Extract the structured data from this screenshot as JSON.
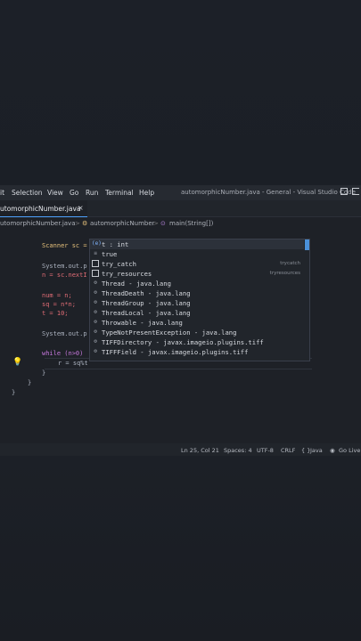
{
  "menubar": {
    "items": [
      "it",
      "Selection",
      "View",
      "Go",
      "Run",
      "Terminal",
      "Help"
    ],
    "window_title": "automorphicNumber.java - General - Visual Studio Code"
  },
  "tab": {
    "label": "utomorphicNumber.java",
    "close": "×"
  },
  "breadcrumb": {
    "file": "utomorphicNumber.java",
    "class": "automorphicNumber",
    "method": "main(String[])",
    "sep": ">"
  },
  "code": {
    "line_scanner": "Scanner sc =",
    "line_print": "System.out.p",
    "line_n": "n = sc.nextI",
    "line_num": "num = n;",
    "line_sq": "sq = n*n;",
    "line_t": "t = 10;",
    "line_print2": "System.out.p",
    "line_while": "while (n>0)",
    "line_r": "r = sq%t",
    "brace_inner": "}",
    "brace_method": "}",
    "brace_class": "}"
  },
  "suggestions": [
    {
      "icon": "t",
      "label": "t : int",
      "detail": ""
    },
    {
      "icon": "kw",
      "label": "true",
      "detail": ""
    },
    {
      "icon": "snip",
      "label": "try_catch",
      "detail": "trycatch"
    },
    {
      "icon": "snip",
      "label": "try_resources",
      "detail": "tryresources"
    },
    {
      "icon": "cls",
      "label": "Thread - java.lang",
      "detail": ""
    },
    {
      "icon": "cls",
      "label": "ThreadDeath - java.lang",
      "detail": ""
    },
    {
      "icon": "cls",
      "label": "ThreadGroup - java.lang",
      "detail": ""
    },
    {
      "icon": "cls",
      "label": "ThreadLocal - java.lang",
      "detail": ""
    },
    {
      "icon": "cls",
      "label": "Throwable - java.lang",
      "detail": ""
    },
    {
      "icon": "cls",
      "label": "TypeNotPresentException - java.lang",
      "detail": ""
    },
    {
      "icon": "cls",
      "label": "TIFFDirectory - javax.imageio.plugins.tiff",
      "detail": ""
    },
    {
      "icon": "cls",
      "label": "TIFFField - javax.imageio.plugins.tiff",
      "detail": ""
    }
  ],
  "statusbar": {
    "position": "Ln 25, Col 21",
    "spaces": "Spaces: 4",
    "encoding": "UTF-8",
    "eol": "CRLF",
    "language": "Java",
    "golive": "Go Live",
    "braces": "{ }"
  },
  "colors": {
    "accent": "#4fa3ff",
    "keyword": "#c678dd",
    "type": "#e5c07b",
    "function": "#61afef"
  }
}
